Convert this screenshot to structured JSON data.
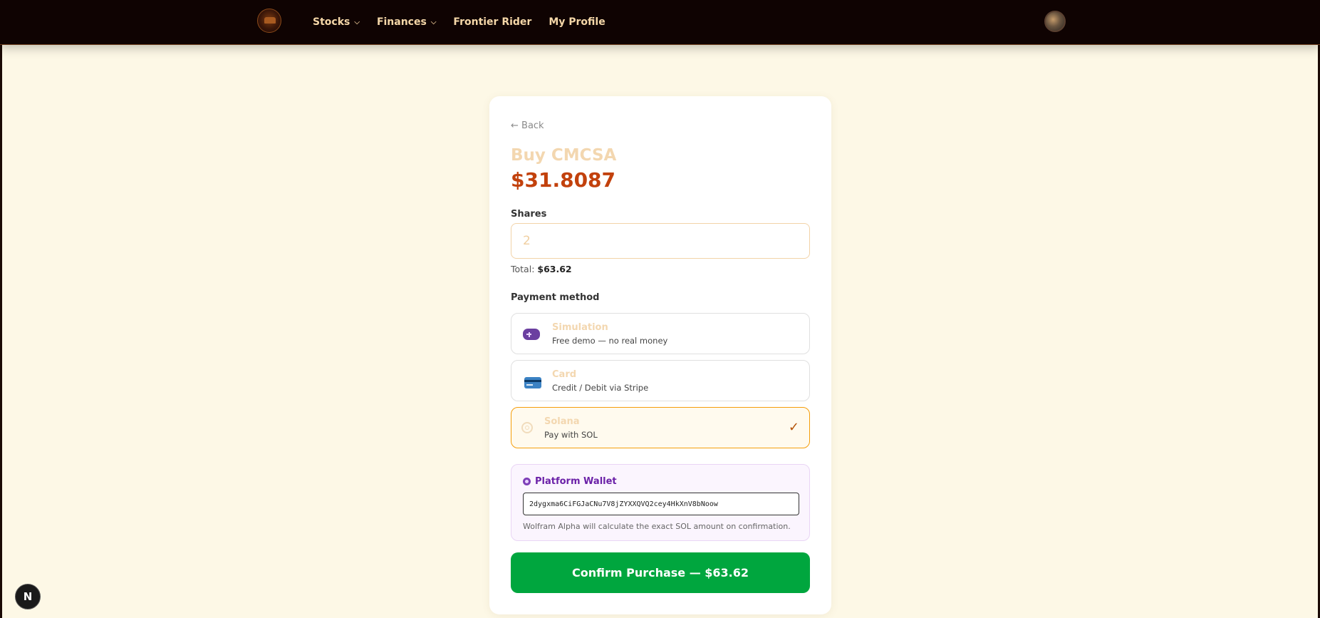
{
  "nav": {
    "items": [
      {
        "label": "Stocks",
        "has_dropdown": true
      },
      {
        "label": "Finances",
        "has_dropdown": true
      },
      {
        "label": "Frontier Rider",
        "has_dropdown": false
      },
      {
        "label": "My Profile",
        "has_dropdown": false
      }
    ]
  },
  "back_label": "← Back",
  "title": "Buy CMCSA",
  "price": "$31.8087",
  "shares": {
    "label": "Shares",
    "value": "2"
  },
  "total": {
    "label": "Total:",
    "value": "$63.62"
  },
  "payment": {
    "label": "Payment method",
    "options": [
      {
        "name": "Simulation",
        "description": "Free demo — no real money",
        "icon": "gamepad-icon",
        "selected": false
      },
      {
        "name": "Card",
        "description": "Credit / Debit via Stripe",
        "icon": "credit-card-icon",
        "selected": false
      },
      {
        "name": "Solana",
        "description": "Pay with SOL",
        "icon": "solana-icon",
        "selected": true
      }
    ],
    "check_glyph": "✓"
  },
  "wallet": {
    "title": "Platform Wallet",
    "address": "2dygxma6CiFGJaCNu7V8jZYXXQVQ2cey4HkXnV8bNoow",
    "note": "Wolfram Alpha will calculate the exact SOL amount on confirmation."
  },
  "confirm_label": "Confirm Purchase — $63.62",
  "dev_badge": "N",
  "colors": {
    "nav_bg": "#0f0302",
    "page_bg": "#fdf8e6",
    "price": "#c2410c",
    "confirm": "#00a63e",
    "selected_border": "#f59e0b",
    "wallet_accent": "#6b21a8"
  }
}
